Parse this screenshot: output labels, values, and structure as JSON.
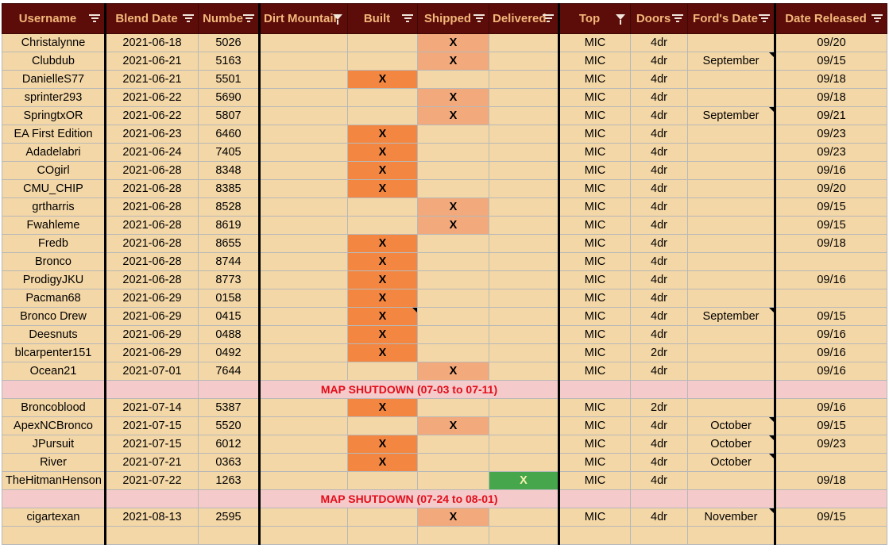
{
  "columns": [
    {
      "label": "Username",
      "filter": "list"
    },
    {
      "label": "Blend Date",
      "filter": "list"
    },
    {
      "label": "Numbe",
      "filter": "list"
    },
    {
      "label": "Dirt Mountair",
      "filter": "funnel"
    },
    {
      "label": "Built",
      "filter": "list"
    },
    {
      "label": "Shipped",
      "filter": "list"
    },
    {
      "label": "Delivered",
      "filter": "list"
    },
    {
      "label": "Top",
      "filter": "funnel"
    },
    {
      "label": "Doors",
      "filter": "list"
    },
    {
      "label": "Ford's Date",
      "filter": "list"
    },
    {
      "label": "Date Released",
      "filter": "list"
    }
  ],
  "rows": [
    {
      "username": "Christalynne",
      "blend_date": "2021-06-18",
      "number": "5026",
      "status": "shipped",
      "top": "MIC",
      "doors": "4dr",
      "ford_date": "",
      "released": "09/20"
    },
    {
      "username": "Clubdub",
      "blend_date": "2021-06-21",
      "number": "5163",
      "status": "shipped",
      "top": "MIC",
      "doors": "4dr",
      "ford_date": "September",
      "ford_note": true,
      "released": "09/15"
    },
    {
      "username": "DanielleS77",
      "blend_date": "2021-06-21",
      "number": "5501",
      "status": "built",
      "top": "MIC",
      "doors": "4dr",
      "ford_date": "",
      "released": "09/18"
    },
    {
      "username": "sprinter293",
      "blend_date": "2021-06-22",
      "number": "5690",
      "status": "shipped",
      "top": "MIC",
      "doors": "4dr",
      "ford_date": "",
      "released": "09/18"
    },
    {
      "username": "SpringtxOR",
      "blend_date": "2021-06-22",
      "number": "5807",
      "status": "shipped",
      "top": "MIC",
      "doors": "4dr",
      "ford_date": "September",
      "ford_note": true,
      "released": "09/21"
    },
    {
      "username": "EA First Edition",
      "blend_date": "2021-06-23",
      "number": "6460",
      "status": "built",
      "top": "MIC",
      "doors": "4dr",
      "ford_date": "",
      "released": "09/23"
    },
    {
      "username": "Adadelabri",
      "blend_date": "2021-06-24",
      "number": "7405",
      "status": "built",
      "top": "MIC",
      "doors": "4dr",
      "ford_date": "",
      "released": "09/23"
    },
    {
      "username": "COgirl",
      "blend_date": "2021-06-28",
      "number": "8348",
      "status": "built",
      "top": "MIC",
      "doors": "4dr",
      "ford_date": "",
      "released": "09/16"
    },
    {
      "username": "CMU_CHIP",
      "blend_date": "2021-06-28",
      "number": "8385",
      "status": "built",
      "top": "MIC",
      "doors": "4dr",
      "ford_date": "",
      "released": "09/20"
    },
    {
      "username": "grtharris",
      "blend_date": "2021-06-28",
      "number": "8528",
      "status": "shipped",
      "top": "MIC",
      "doors": "4dr",
      "ford_date": "",
      "released": "09/15"
    },
    {
      "username": "Fwahleme",
      "blend_date": "2021-06-28",
      "number": "8619",
      "status": "shipped",
      "top": "MIC",
      "doors": "4dr",
      "ford_date": "",
      "released": "09/15"
    },
    {
      "username": "Fredb",
      "blend_date": "2021-06-28",
      "number": "8655",
      "status": "built",
      "top": "MIC",
      "doors": "4dr",
      "ford_date": "",
      "released": "09/18"
    },
    {
      "username": "Bronco",
      "blend_date": "2021-06-28",
      "number": "8744",
      "status": "built",
      "top": "MIC",
      "doors": "4dr",
      "ford_date": "",
      "released": ""
    },
    {
      "username": "ProdigyJKU",
      "blend_date": "2021-06-28",
      "number": "8773",
      "status": "built",
      "top": "MIC",
      "doors": "4dr",
      "ford_date": "",
      "released": "09/16"
    },
    {
      "username": "Pacman68",
      "blend_date": "2021-06-29",
      "number": "0158",
      "status": "built",
      "top": "MIC",
      "doors": "4dr",
      "ford_date": "",
      "released": ""
    },
    {
      "username": "Bronco Drew",
      "blend_date": "2021-06-29",
      "number": "0415",
      "status": "built",
      "built_note": true,
      "top": "MIC",
      "doors": "4dr",
      "ford_date": "September",
      "ford_note": true,
      "released": "09/15"
    },
    {
      "username": "Deesnuts",
      "blend_date": "2021-06-29",
      "number": "0488",
      "status": "built",
      "top": "MIC",
      "doors": "4dr",
      "ford_date": "",
      "released": "09/16"
    },
    {
      "username": "blcarpenter151",
      "blend_date": "2021-06-29",
      "number": "0492",
      "status": "built",
      "top": "MIC",
      "doors": "2dr",
      "ford_date": "",
      "released": "09/16"
    },
    {
      "username": "Ocean21",
      "blend_date": "2021-07-01",
      "number": "7644",
      "status": "shipped",
      "top": "MIC",
      "doors": "4dr",
      "ford_date": "",
      "released": "09/16"
    },
    {
      "banner": "MAP SHUTDOWN (07-03 to 07-11)"
    },
    {
      "username": "Broncoblood",
      "blend_date": "2021-07-14",
      "number": "5387",
      "status": "built",
      "top": "MIC",
      "doors": "2dr",
      "ford_date": "",
      "released": "09/16"
    },
    {
      "username": "ApexNCBronco",
      "blend_date": "2021-07-15",
      "number": "5520",
      "status": "shipped",
      "top": "MIC",
      "doors": "4dr",
      "ford_date": "October",
      "ford_note": true,
      "released": "09/15"
    },
    {
      "username": "JPursuit",
      "blend_date": "2021-07-15",
      "number": "6012",
      "status": "built",
      "top": "MIC",
      "doors": "4dr",
      "ford_date": "October",
      "ford_note": true,
      "released": "09/23"
    },
    {
      "username": "River",
      "blend_date": "2021-07-21",
      "number": "0363",
      "status": "built",
      "top": "MIC",
      "doors": "4dr",
      "ford_date": "October",
      "ford_note": true,
      "released": ""
    },
    {
      "username": "TheHitmanHenson",
      "blend_date": "2021-07-22",
      "number": "1263",
      "status": "delivered",
      "top": "MIC",
      "doors": "4dr",
      "ford_date": "",
      "released": "09/18"
    },
    {
      "banner": "MAP SHUTDOWN (07-24 to 08-01)"
    },
    {
      "username": "cigartexan",
      "blend_date": "2021-08-13",
      "number": "2595",
      "status": "shipped",
      "top": "MIC",
      "doors": "4dr",
      "ford_date": "November",
      "ford_note": true,
      "released": "09/15"
    },
    {
      "empty": true
    }
  ],
  "mark": "X",
  "colors": {
    "header_bg": "#5c0d0a",
    "header_text": "#f3b77a",
    "cell_bg": "#f4d7a6",
    "built": "#f38742",
    "shipped": "#f2a97b",
    "delivered": "#45a64b",
    "shutdown_bg": "#f5caca",
    "shutdown_text": "#e30d1a"
  }
}
